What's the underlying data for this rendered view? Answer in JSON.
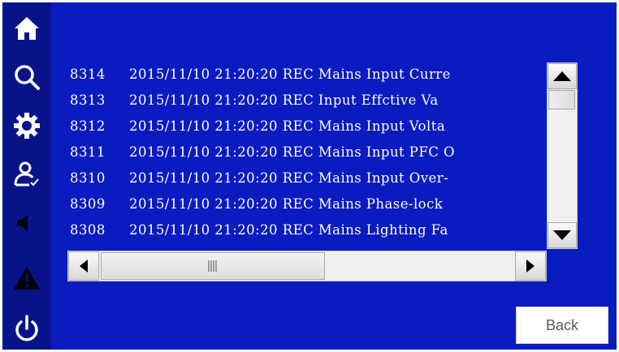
{
  "sidebar": {
    "items": [
      {
        "icon": "home-icon"
      },
      {
        "icon": "search-icon"
      },
      {
        "icon": "gear-icon"
      },
      {
        "icon": "user-check-icon"
      },
      {
        "icon": "speaker-icon"
      },
      {
        "icon": "warning-icon"
      },
      {
        "icon": "power-icon"
      }
    ]
  },
  "log": {
    "rows": [
      {
        "id": "8314",
        "text": "2015/11/10 21:20:20 REC Mains Input Curre"
      },
      {
        "id": "8313",
        "text": "2015/11/10 21:20:20 REC Input Effctive Va"
      },
      {
        "id": "8312",
        "text": "2015/11/10 21:20:20 REC Mains Input Volta"
      },
      {
        "id": "8311",
        "text": "2015/11/10 21:20:20 REC Mains Input PFC O"
      },
      {
        "id": "8310",
        "text": "2015/11/10 21:20:20 REC Mains Input Over-"
      },
      {
        "id": "8309",
        "text": "2015/11/10 21:20:20 REC Mains Phase-lock"
      },
      {
        "id": "8308",
        "text": "2015/11/10 21:20:20 REC Mains Lighting Fa"
      }
    ]
  },
  "buttons": {
    "back_label": "Back"
  },
  "colors": {
    "background": "#0a1bc0",
    "sidebar": "#08138a",
    "text": "#ffffff"
  }
}
